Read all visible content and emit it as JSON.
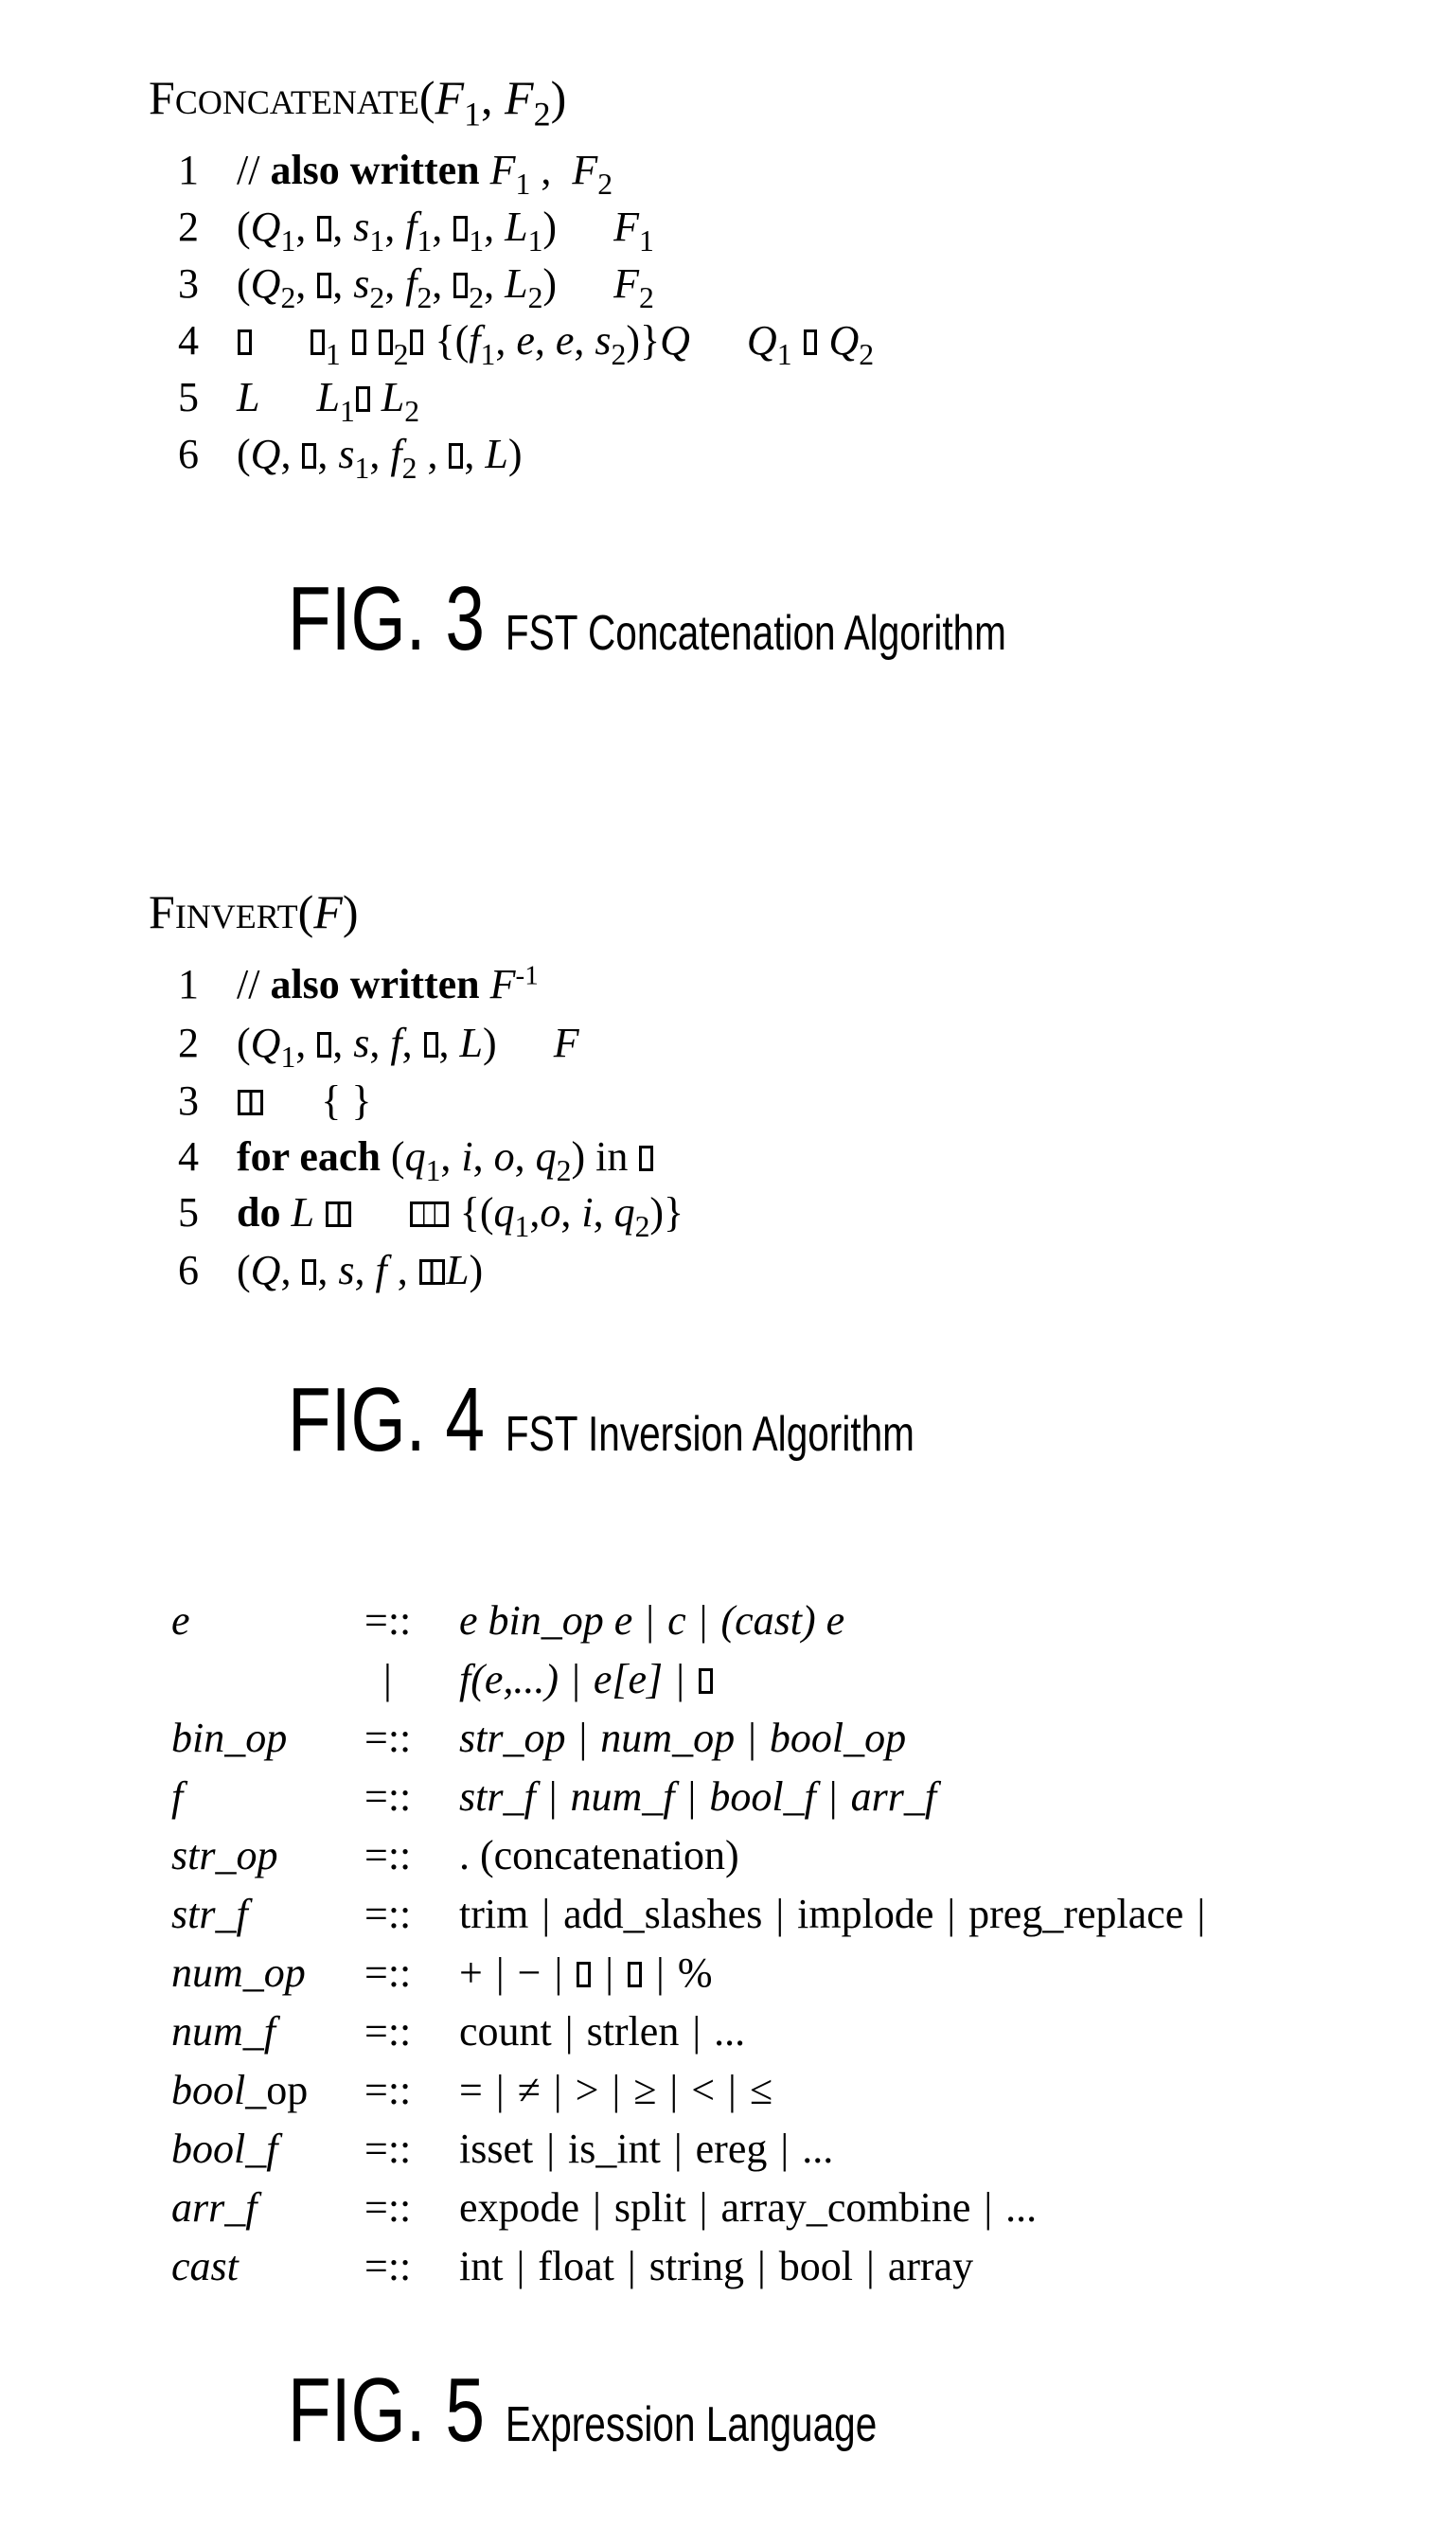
{
  "fig3": {
    "title": {
      "prefix": "F",
      "smallcaps": "CONCATENATE",
      "args_open": "(",
      "arg1": "F",
      "arg1_sub": "1",
      "sep": ", ",
      "arg2": "F",
      "arg2_sub": "2",
      "args_close": ")"
    },
    "lines": [
      {
        "num": "1",
        "comment_slashes": "// ",
        "comment_bold": "also written ",
        "comment_f1": "F",
        "comment_f1_sub": "1",
        "comment_sep": " ,  ",
        "comment_f2": "F",
        "comment_f2_sub": "2"
      },
      {
        "num": "2",
        "text": "(Q1, □, s1, f1, □1, L1) ← F1"
      },
      {
        "num": "3",
        "text": "(Q2, □, s2, f2, □2, L2) ← F2"
      },
      {
        "num": "4",
        "text": "□ ← □1 □ □2 □ {(f1, e, e, s2)}Q ← Q1 □ Q2"
      },
      {
        "num": "5",
        "text": "L ← L1 □ L2"
      },
      {
        "num": "6",
        "text": "(Q, □, s1, f2, □, L)"
      }
    ],
    "caption": {
      "label": "FIG. 3",
      "text": "FST Concatenation Algorithm"
    }
  },
  "fig4": {
    "title": {
      "prefix": "F",
      "smallcaps": "INVERT",
      "args_open": "(",
      "arg": "F",
      "args_close": ")"
    },
    "lines": [
      {
        "num": "1",
        "comment_slashes": "// ",
        "comment_bold": "also written ",
        "comment_f": "F",
        "comment_sup": "-1"
      },
      {
        "num": "2",
        "text": "(Q1, □, s, f, □, L) ← F"
      },
      {
        "num": "3",
        "text": "□□ ← { }"
      },
      {
        "num": "4",
        "keyword": "for each ",
        "text": "(q1, i, o, q2) in □"
      },
      {
        "num": "5",
        "keyword": "do ",
        "text": "L □□ ← □□□ {(q1,o, i, q2)}"
      },
      {
        "num": "6",
        "text": "(Q, □, s, f , □□, L)"
      }
    ],
    "caption": {
      "label": "FIG. 4",
      "text": "FST Inversion Algorithm"
    }
  },
  "fig5": {
    "rules": [
      {
        "lhs": "e",
        "op": "=::",
        "rhs": [
          "e bin_op e",
          "c",
          "(cast) e"
        ],
        "rhs_italic": true
      },
      {
        "lhs": "",
        "op": "|",
        "rhs": [
          "f(e,...)",
          "e[e]",
          "□"
        ],
        "rhs_italic": true
      },
      {
        "lhs": "bin_op",
        "op": "=::",
        "rhs": [
          "str_op",
          "num_op",
          "bool_op"
        ],
        "rhs_italic": true
      },
      {
        "lhs": "f",
        "op": "=::",
        "rhs": [
          "str_f",
          "num_f",
          "bool_f",
          "arr_f"
        ],
        "rhs_italic": true
      },
      {
        "lhs": "str_op",
        "op": "=::",
        "rhs": [
          ". (concatenation)"
        ],
        "rhs_italic": false
      },
      {
        "lhs": "str_f",
        "op": "=::",
        "rhs": [
          "trim",
          "add_slashes",
          "implode",
          "preg_replace",
          ""
        ],
        "rhs_italic": false
      },
      {
        "lhs": "num_op",
        "op": "=::",
        "rhs": [
          "+",
          "−",
          "□",
          "□",
          "%"
        ],
        "rhs_italic": false
      },
      {
        "lhs": "num_f",
        "op": "=::",
        "rhs": [
          "count",
          "strlen",
          "..."
        ],
        "rhs_italic": false
      },
      {
        "lhs": "bool_op",
        "lhs_part_italic": "bool",
        "lhs_part_roman": "_op",
        "op": "=::",
        "rhs": [
          "=",
          "≠",
          ">",
          "≥",
          "<",
          "≤"
        ],
        "rhs_italic": false
      },
      {
        "lhs": "bool_f",
        "op": "=::",
        "rhs": [
          "isset",
          "is_int",
          "ereg",
          "..."
        ],
        "rhs_italic": false
      },
      {
        "lhs": "arr_f",
        "op": "=::",
        "rhs": [
          "expode",
          "split",
          "array_combine",
          "..."
        ],
        "rhs_italic": false
      },
      {
        "lhs": "cast",
        "op": "=::",
        "rhs": [
          "int",
          "float",
          "string",
          "bool",
          "array"
        ],
        "rhs_italic": false
      }
    ],
    "caption": {
      "label": "FIG. 5",
      "text": "Expression Language"
    }
  }
}
